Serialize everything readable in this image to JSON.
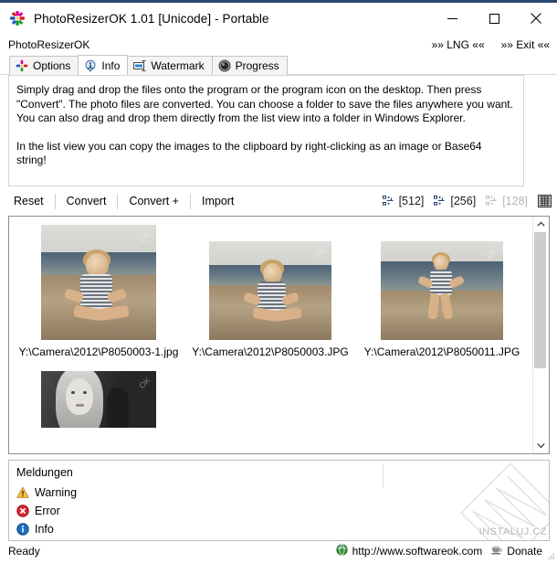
{
  "window": {
    "title": "PhotoResizerOK 1.01 [Unicode] - Portable",
    "app_icon": "pinwheel-icon",
    "accent_color": "#2b4a70",
    "controls": {
      "minimize": "minimize-button",
      "maximize": "maximize-button",
      "close": "close-button"
    }
  },
  "subbar": {
    "app_name": "PhotoResizerOK",
    "language_link": "»» LNG ««",
    "exit_link": "»» Exit ««"
  },
  "tabs": [
    {
      "label": "Options",
      "icon": "pinwheel-icon",
      "active": false
    },
    {
      "label": "Info",
      "icon": "info-icon",
      "active": true
    },
    {
      "label": "Watermark",
      "icon": "watermark-icon",
      "active": false
    },
    {
      "label": "Progress",
      "icon": "progress-icon",
      "active": false
    }
  ],
  "info": {
    "paragraph1": "Simply drag and drop the files onto the program or the program icon on the desktop. Then press \"Convert\". The photo files are converted. You can choose a folder to save the files anywhere you want. You can also drag and drop them directly from the list view into a folder in Windows Explorer.",
    "paragraph2": "In the list view you can copy the images to the clipboard by right-clicking as an image or Base64 string!"
  },
  "toolbar": {
    "buttons": [
      {
        "label": "Reset"
      },
      {
        "label": "Convert"
      },
      {
        "label": "Convert +"
      },
      {
        "label": "Import"
      }
    ],
    "sizes": [
      {
        "label": "[512]",
        "enabled": true,
        "icon": "thumbnail-size-icon"
      },
      {
        "label": "[256]",
        "enabled": true,
        "icon": "thumbnail-size-icon"
      },
      {
        "label": "[128]",
        "enabled": false,
        "icon": "thumbnail-size-icon"
      }
    ],
    "details_view_icon": "grid-view-icon"
  },
  "listview": {
    "items": [
      {
        "label": "Y:\\Camera\\2012\\P8050003-1.jpg",
        "watermark": "OK"
      },
      {
        "label": "Y:\\Camera\\2012\\P8050003.JPG",
        "watermark": "OK"
      },
      {
        "label": "Y:\\Camera\\2012\\P8050011.JPG",
        "watermark": "OK"
      },
      {
        "label": "",
        "watermark": "OK"
      }
    ],
    "scrollbar": {
      "up_arrow": "chevron-up-icon",
      "down_arrow": "chevron-down-icon"
    }
  },
  "messages": {
    "title": "Meldungen",
    "rows": [
      {
        "label": "Warning",
        "icon": "warning-icon",
        "color": "#f0ad1e"
      },
      {
        "label": "Error",
        "icon": "error-icon",
        "color": "#d8242c"
      },
      {
        "label": "Info",
        "icon": "info-icon",
        "color": "#1a6fc4"
      }
    ],
    "watermark_text": "INSTALUJ.CZ"
  },
  "statusbar": {
    "status": "Ready",
    "website": "http://www.softwareok.com",
    "website_icon": "globe-icon",
    "donate": "Donate",
    "donate_icon": "coffee-icon",
    "resize_grip": "resize-grip-icon"
  }
}
